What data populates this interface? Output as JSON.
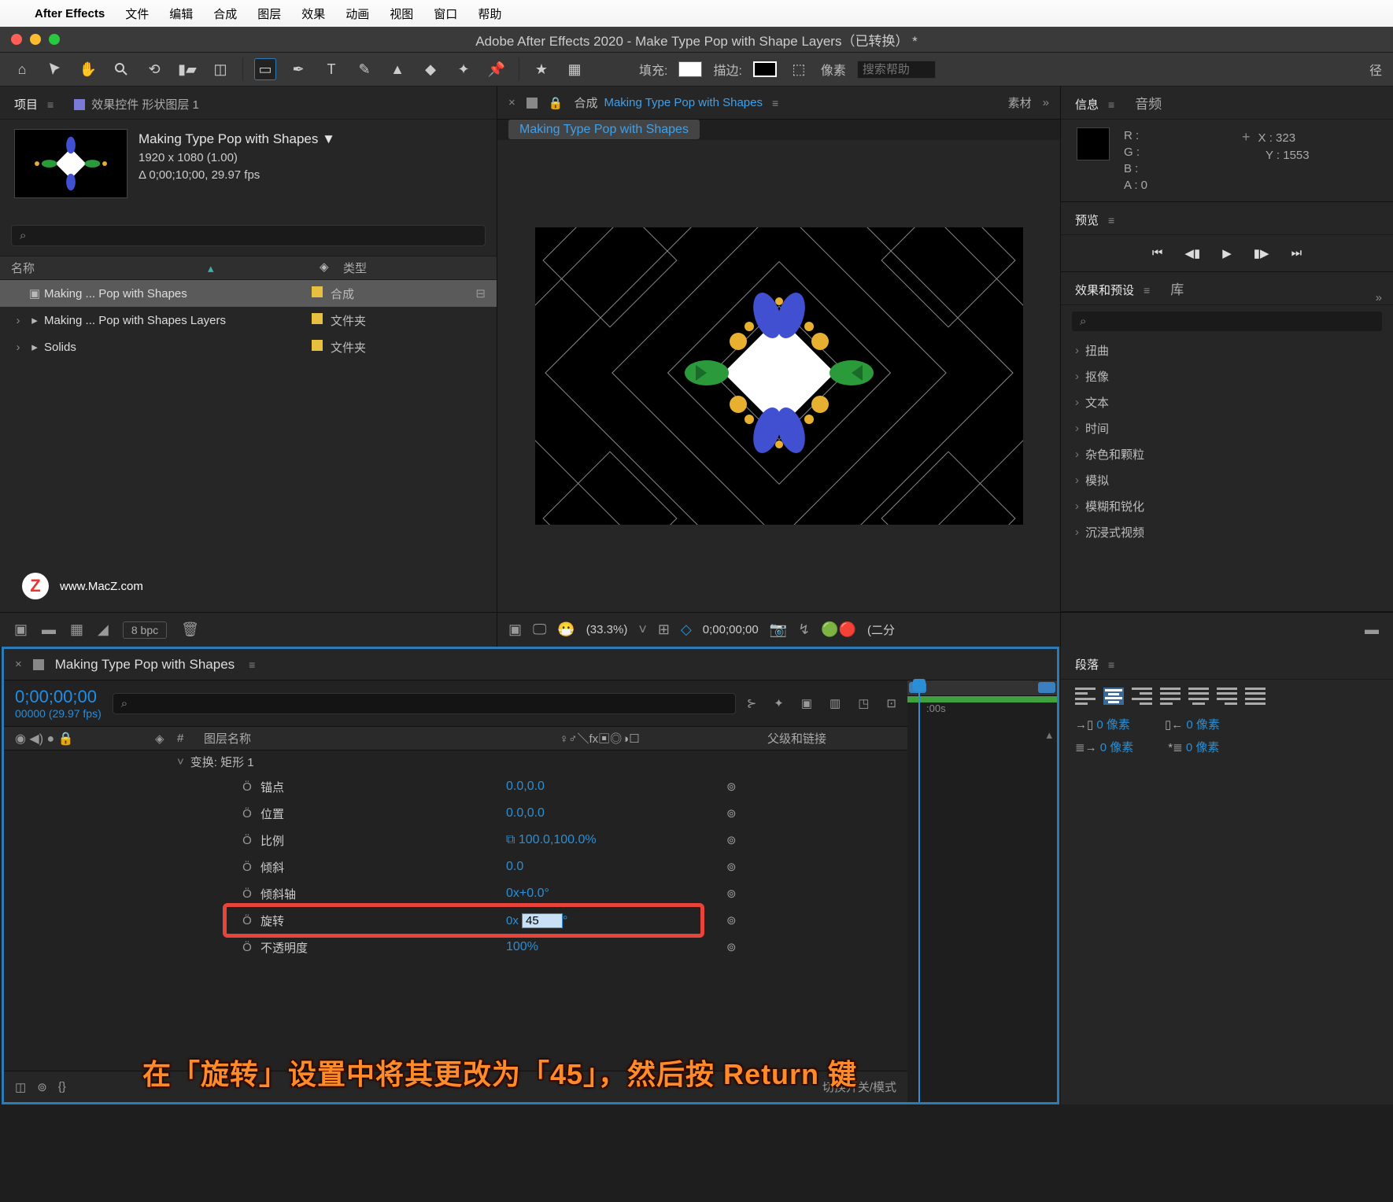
{
  "menubar": {
    "items": [
      "文件",
      "编辑",
      "合成",
      "图层",
      "效果",
      "动画",
      "视图",
      "窗口",
      "帮助"
    ],
    "app": "After Effects"
  },
  "window_title": "Adobe After Effects 2020 - Make Type Pop with Shape Layers（已转换） *",
  "toolbar": {
    "fill_label": "填充:",
    "stroke_label": "描边:",
    "px_label": "像素",
    "search_placeholder": "搜索帮助",
    "radius_label": "径"
  },
  "project_panel": {
    "tab_project": "项目",
    "tab_effect_controls": "效果控件 形状图层 1",
    "item_title": "Making Type Pop with Shapes ▼",
    "item_dim": "1920 x 1080 (1.00)",
    "item_dur": "Δ 0;00;10;00, 29.97 fps",
    "search_placeholder": "",
    "col_name": "名称",
    "col_type": "类型",
    "rows": [
      {
        "twist": "",
        "icon": "▣",
        "name": "Making ... Pop with Shapes",
        "type": "合成",
        "sel": true
      },
      {
        "twist": "›",
        "icon": "▸",
        "name": "Making ... Pop with Shapes Layers",
        "type": "文件夹",
        "sel": false
      },
      {
        "twist": "›",
        "icon": "▸",
        "name": "Solids",
        "type": "文件夹",
        "sel": false
      }
    ],
    "bpc": "8 bpc"
  },
  "watermark": "www.MacZ.com",
  "comp_panel": {
    "prefix_label": "合成",
    "comp_name": "Making Type Pop with Shapes",
    "tab_sub": "素材",
    "tab_name": "Making Type Pop with Shapes"
  },
  "viewer": {
    "zoom": "(33.3%)",
    "time": "0;00;00;00",
    "res": "(二分"
  },
  "info_panel": {
    "tab_info": "信息",
    "tab_audio": "音频",
    "r": "R :",
    "g": "G :",
    "b": "B :",
    "a": "A :  0",
    "x": "X : 323",
    "y": "Y :  1553"
  },
  "preview_panel": {
    "tab": "预览"
  },
  "effects_panel": {
    "tab_eff": "效果和预设",
    "tab_lib": "库",
    "items": [
      "扭曲",
      "抠像",
      "文本",
      "时间",
      "杂色和颗粒",
      "模拟",
      "模糊和锐化",
      "沉浸式视频"
    ]
  },
  "timeline": {
    "tab_name": "Making Type Pop with Shapes",
    "time": "0;00;00;00",
    "time_sub": "00000 (29.97 fps)",
    "col_num": "#",
    "col_layer": "图层名称",
    "col_switches": "♀♂＼fx▣◎◑☐",
    "col_parent": "父级和链接",
    "group": "变换: 矩形 1",
    "props": [
      {
        "name": "锚点",
        "val": "0.0,0.0",
        "link": "⊚"
      },
      {
        "name": "位置",
        "val": "0.0,0.0",
        "link": "⊚"
      },
      {
        "name": "比例",
        "val": "100.0,100.0%",
        "link": "⊚",
        "chain": true
      },
      {
        "name": "倾斜",
        "val": "0.0",
        "link": "⊚"
      },
      {
        "name": "倾斜轴",
        "val": "0x+0.0°",
        "link": "⊚"
      },
      {
        "name": "旋转",
        "val": "0x ",
        "input": "45",
        "link": "⊚",
        "hl": true
      },
      {
        "name": "不透明度",
        "val": "100%",
        "link": "⊚"
      }
    ],
    "ruler_label": ":00s",
    "toggle_label": "切换开关/模式"
  },
  "overlay": "在「旋转」设置中将其更改为「45」，然后按 Return 键",
  "paragraph_panel": {
    "tab": "段落",
    "v1": "0 像素",
    "v2": "0 像素",
    "v3": "0 像素",
    "v4": "0 像素"
  }
}
